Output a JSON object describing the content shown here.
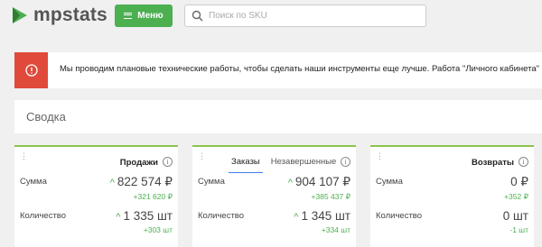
{
  "header": {
    "logo_text": "mpstats",
    "menu_label": "Меню",
    "search_placeholder": "Поиск по SKU"
  },
  "alert": {
    "icon": "info-icon",
    "text": "Мы проводим плановые технические работы, чтобы сделать наши инструменты еще лучше. Работа \"Личного кабинета\" скоро стабилизируется"
  },
  "summary": {
    "title": "Сводка"
  },
  "colors": {
    "accent": "#4caf50",
    "alert": "#e04a3a",
    "tab_underline": "#3f7ff0"
  },
  "cards": [
    {
      "title": "Продажи",
      "sum_label": "Сумма",
      "sum_value": "822 574 ₽",
      "sum_delta": "+321 620 ₽",
      "qty_label": "Количество",
      "qty_value": "1 335 шт",
      "qty_delta": "+303 шт"
    },
    {
      "tabs": [
        "Заказы",
        "Незавершенные"
      ],
      "active_tab": "Заказы",
      "sum_label": "Сумма",
      "sum_value": "904 107 ₽",
      "sum_delta": "+385 437 ₽",
      "qty_label": "Количество",
      "qty_value": "1 345 шт",
      "qty_delta": "+334 шт"
    },
    {
      "title": "Возвраты",
      "sum_label": "Сумма",
      "sum_value": "0 ₽",
      "sum_delta": "+352 ₽",
      "qty_label": "Количество",
      "qty_value": "0 шт",
      "qty_delta": "-1 шт"
    }
  ]
}
